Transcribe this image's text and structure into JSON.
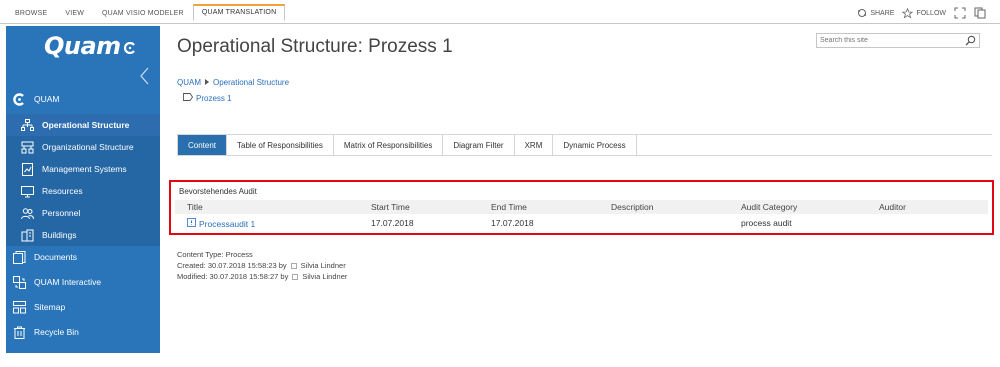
{
  "ribbon": {
    "tabs": [
      "BROWSE",
      "VIEW",
      "QUAM VISIO MODELER",
      "QUAM TRANSLATION"
    ],
    "actions": {
      "share": "SHARE",
      "follow": "FOLLOW"
    }
  },
  "sidebar": {
    "logo": "Quam",
    "items": [
      {
        "label": "QUAM",
        "icon": "quam-logo-icon"
      },
      {
        "label": "Operational Structure",
        "icon": "org-chart-icon",
        "selected": true
      },
      {
        "label": "Organizational Structure",
        "icon": "hierarchy-icon"
      },
      {
        "label": "Management Systems",
        "icon": "document-chart-icon"
      },
      {
        "label": "Resources",
        "icon": "resources-icon"
      },
      {
        "label": "Personnel",
        "icon": "people-icon"
      },
      {
        "label": "Buildings",
        "icon": "building-icon"
      },
      {
        "label": "Documents",
        "icon": "documents-icon"
      },
      {
        "label": "QUAM Interactive",
        "icon": "interactive-icon"
      },
      {
        "label": "Sitemap",
        "icon": "sitemap-icon"
      },
      {
        "label": "Recycle Bin",
        "icon": "recycle-bin-icon"
      }
    ]
  },
  "page": {
    "title": "Operational Structure: Prozess 1",
    "search_placeholder": "Search this site",
    "breadcrumb": {
      "root": "QUAM",
      "current": "Operational Structure",
      "sub": "Prozess 1"
    }
  },
  "tabs": [
    "Content",
    "Table of Responsibilities",
    "Matrix of Responsibilities",
    "Diagram Filter",
    "XRM",
    "Dynamic Process"
  ],
  "audit": {
    "title": "Bevorstehendes Audit",
    "columns": [
      "Title",
      "Start Time",
      "End Time",
      "Description",
      "Audit Category",
      "Auditor"
    ],
    "rows": [
      {
        "title": "Processaudit 1",
        "start": "17.07.2018",
        "end": "17.07.2018",
        "description": "",
        "category": "process audit",
        "auditor": ""
      }
    ]
  },
  "meta": {
    "content_type": "Content Type: Process",
    "created_prefix": "Created: 30.07.2018 15:58:23 by",
    "created_user": "Silvia Lindner",
    "modified_prefix": "Modified: 30.07.2018 15:58:27 by",
    "modified_user": "Silvia Lindner"
  },
  "colors": {
    "sidebar": "#2a75b9",
    "accent_tab": "#f3a33c",
    "active_tab": "#2a6fad",
    "highlight": "#e30613",
    "link": "#2a6fc0"
  }
}
